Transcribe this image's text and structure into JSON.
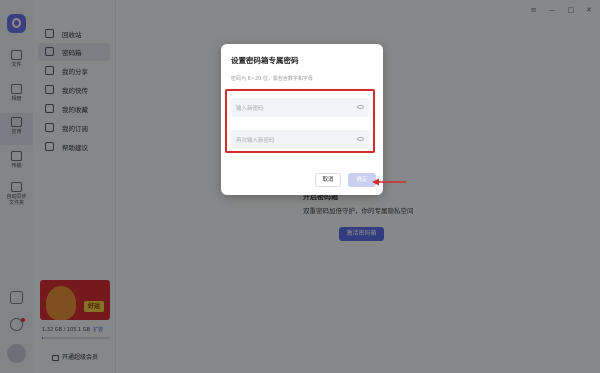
{
  "window": {
    "controls": [
      "≡",
      "—",
      "□",
      "✕"
    ]
  },
  "rail": {
    "items": [
      {
        "label": "文件",
        "icon": "folder-icon"
      },
      {
        "label": "相册",
        "icon": "image-icon"
      },
      {
        "label": "应用",
        "icon": "apps-icon"
      },
      {
        "label": "传输",
        "icon": "transfer-icon"
      },
      {
        "label": "自动同步\n文件夹",
        "icon": "sync-icon"
      }
    ]
  },
  "sidebar": {
    "items": [
      {
        "label": "回收站",
        "icon": "trash-icon"
      },
      {
        "label": "密码箱",
        "icon": "safe-icon"
      },
      {
        "label": "我的分享",
        "icon": "share-icon"
      },
      {
        "label": "我的快传",
        "icon": "cloud-upload-icon"
      },
      {
        "label": "我的收藏",
        "icon": "heart-icon"
      },
      {
        "label": "我的订阅",
        "icon": "bookmark-icon"
      },
      {
        "label": "帮助建议",
        "icon": "help-icon"
      }
    ],
    "promo_tag": "好运",
    "storage_text": "1.32 GB / 105.1 GB",
    "storage_link": "扩容",
    "storage_fraction": 0.0126,
    "vip_label": "开通超级会员"
  },
  "main": {
    "title": "开启密码箱",
    "desc": "双重密码加倍守护，你的专属隐私空间",
    "button": "激活密码箱"
  },
  "dialog": {
    "title": "设置密码箱专属密码",
    "hint": "密码为 6~20 位，需包含数字和字母",
    "password_placeholder": "输入新密码",
    "confirm_placeholder": "再次输入新密码",
    "cancel": "取消",
    "ok": "确定"
  },
  "colors": {
    "accent": "#5a6ee8",
    "highlight": "#d42a2a"
  }
}
